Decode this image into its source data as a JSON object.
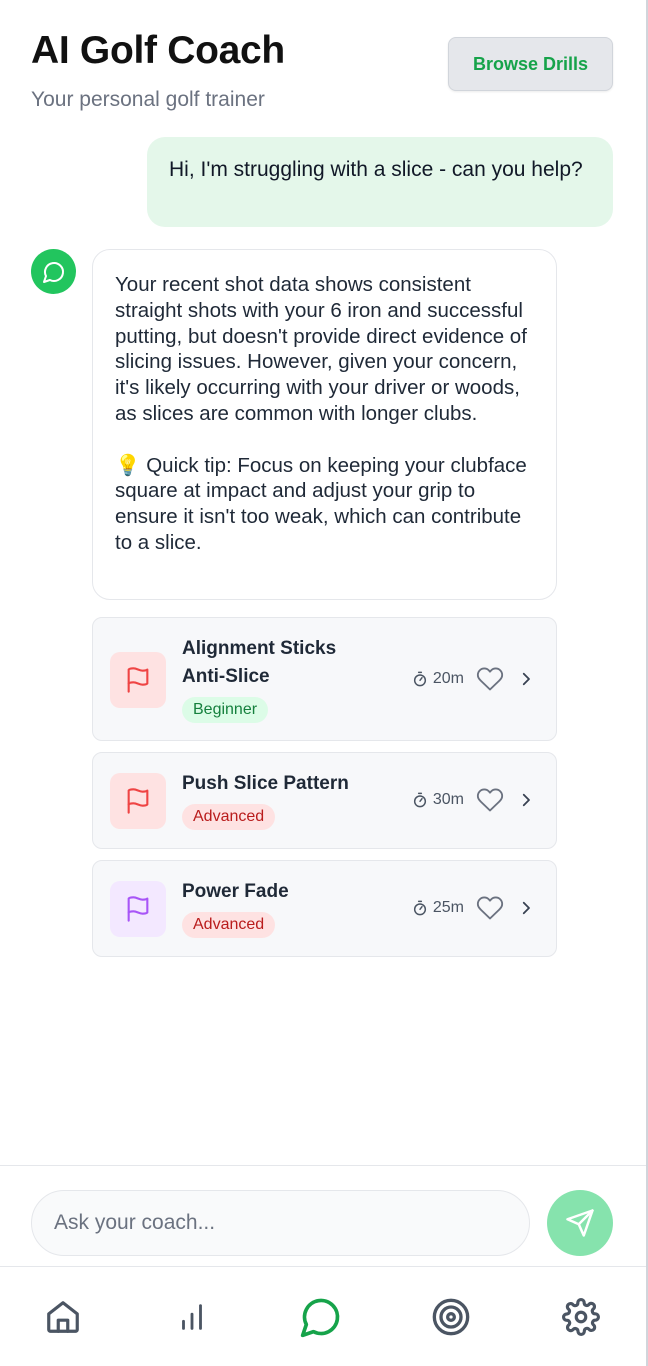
{
  "header": {
    "title": "AI Golf Coach",
    "subtitle": "Your personal golf trainer",
    "browse_label": "Browse Drills"
  },
  "chat": {
    "user_message": "Hi, I'm struggling with a slice - can you help?",
    "coach_paragraph_1": "Your recent shot data shows consistent straight shots with your 6 iron and successful putting, but doesn't provide direct evidence of slicing issues. However, given your concern, it's likely occurring with your driver or woods, as slices are common with longer clubs.",
    "coach_paragraph_2": "💡 Quick tip: Focus on keeping your clubface square at impact and adjust your grip to ensure it isn't too weak, which can contribute to a slice."
  },
  "drills": [
    {
      "name": "Alignment Sticks Anti-Slice",
      "level": "Beginner",
      "duration": "20m",
      "icon": "flag-icon",
      "icon_color": "#ef4444",
      "icon_bg": "#fee2e2"
    },
    {
      "name": "Push Slice Pattern",
      "level": "Advanced",
      "duration": "30m",
      "icon": "flag-icon",
      "icon_color": "#ef4444",
      "icon_bg": "#fee2e2"
    },
    {
      "name": "Power Fade",
      "level": "Advanced",
      "duration": "25m",
      "icon": "flag-icon",
      "icon_color": "#a855f7",
      "icon_bg": "#f3e8ff"
    }
  ],
  "composer": {
    "placeholder": "Ask your coach...",
    "value": ""
  },
  "nav": {
    "items": [
      {
        "icon": "home-icon",
        "active": false
      },
      {
        "icon": "stats-icon",
        "active": false
      },
      {
        "icon": "chat-icon",
        "active": true
      },
      {
        "icon": "target-icon",
        "active": false
      },
      {
        "icon": "settings-icon",
        "active": false
      }
    ]
  },
  "colors": {
    "accent": "#22c55e",
    "accent_text": "#16a34a",
    "user_bubble": "#e4f7ea",
    "send_button": "#86e3ad",
    "nav_inactive": "#4b5563"
  }
}
